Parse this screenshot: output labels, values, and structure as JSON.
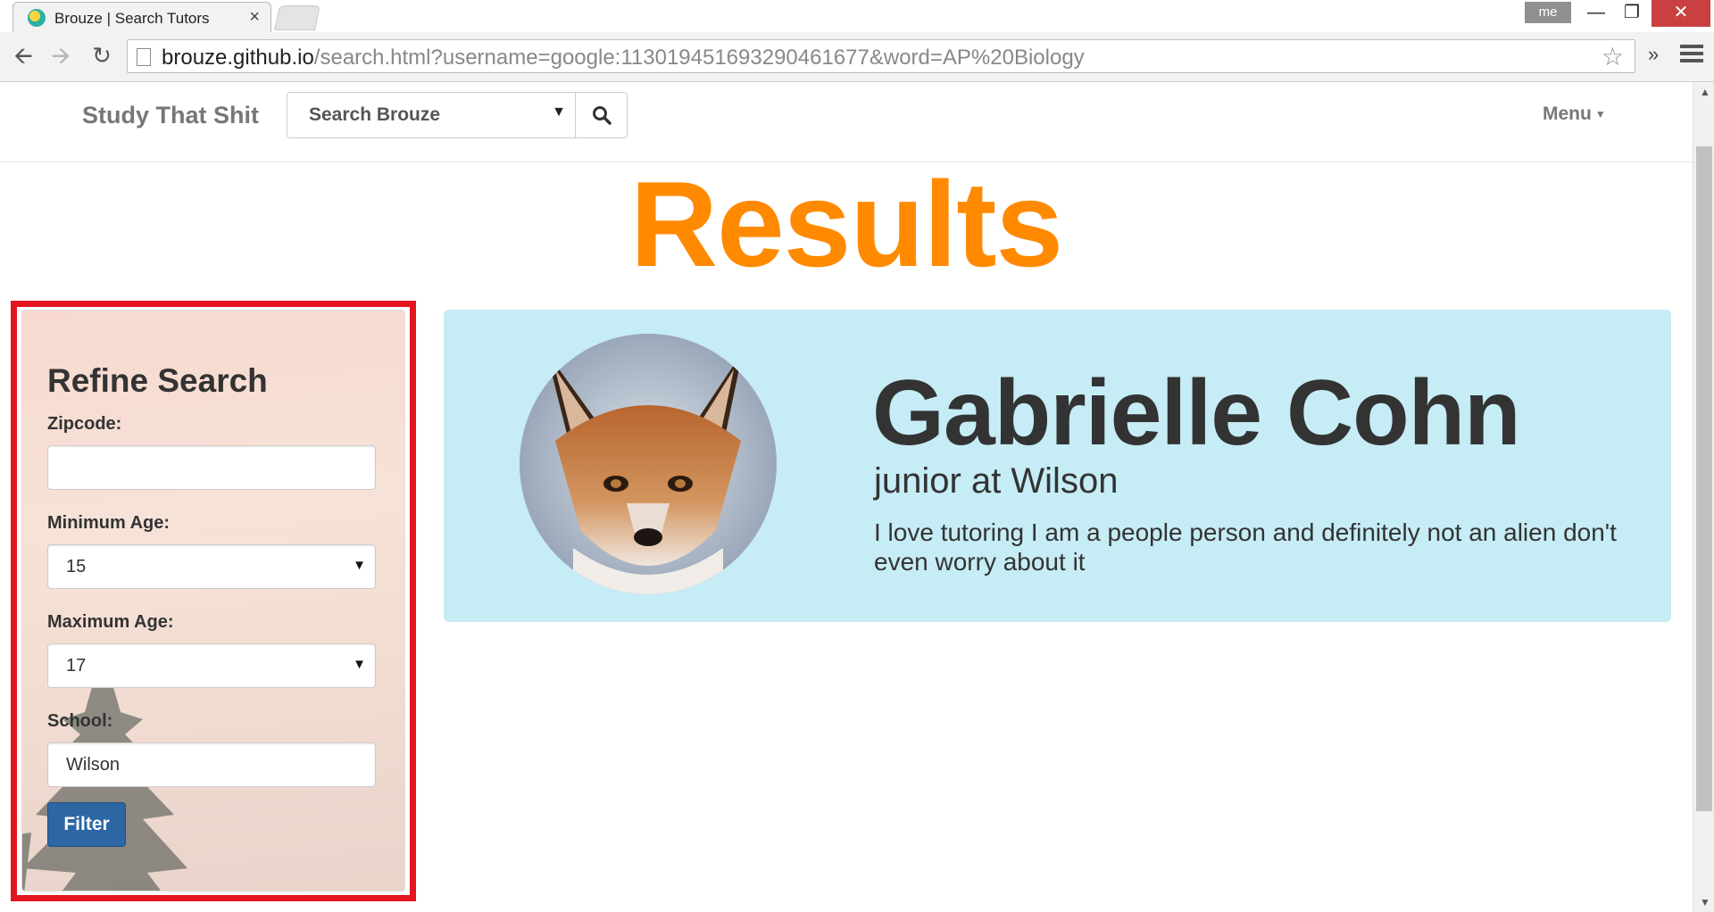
{
  "browser": {
    "tab_title": "Brouze | Search Tutors",
    "tab_close": "×",
    "user_badge": "me",
    "url_host": "brouze.github.io",
    "url_path": "/search.html?username=google:113019451693290461677&word=AP%20Biology",
    "extensions_label": "»"
  },
  "navbar": {
    "brand": "Study That Shit",
    "search_select_value": "Search Brouze",
    "menu_label": "Menu"
  },
  "page": {
    "title": "Results"
  },
  "refine": {
    "title": "Refine Search",
    "zipcode_label": "Zipcode:",
    "zipcode_value": "",
    "min_age_label": "Minimum Age:",
    "min_age_value": "15",
    "max_age_label": "Maximum Age:",
    "max_age_value": "17",
    "school_label": "School:",
    "school_value": "Wilson",
    "filter_label": "Filter"
  },
  "results": [
    {
      "name": "Gabrielle Cohn",
      "subtitle": "junior at Wilson",
      "bio": "I love tutoring I am a people person and definitely not an alien don't even worry about it"
    }
  ],
  "colors": {
    "accent": "#ff8a00",
    "card_bg": "#c6ecf5",
    "filter_button": "#2c66a3",
    "highlight": "#e3151f"
  },
  "icons": {
    "search": "search-icon",
    "back": "back-arrow-icon",
    "forward": "forward-arrow-icon",
    "reload": "reload-icon",
    "star": "star-icon",
    "menu": "hamburger-menu-icon"
  }
}
